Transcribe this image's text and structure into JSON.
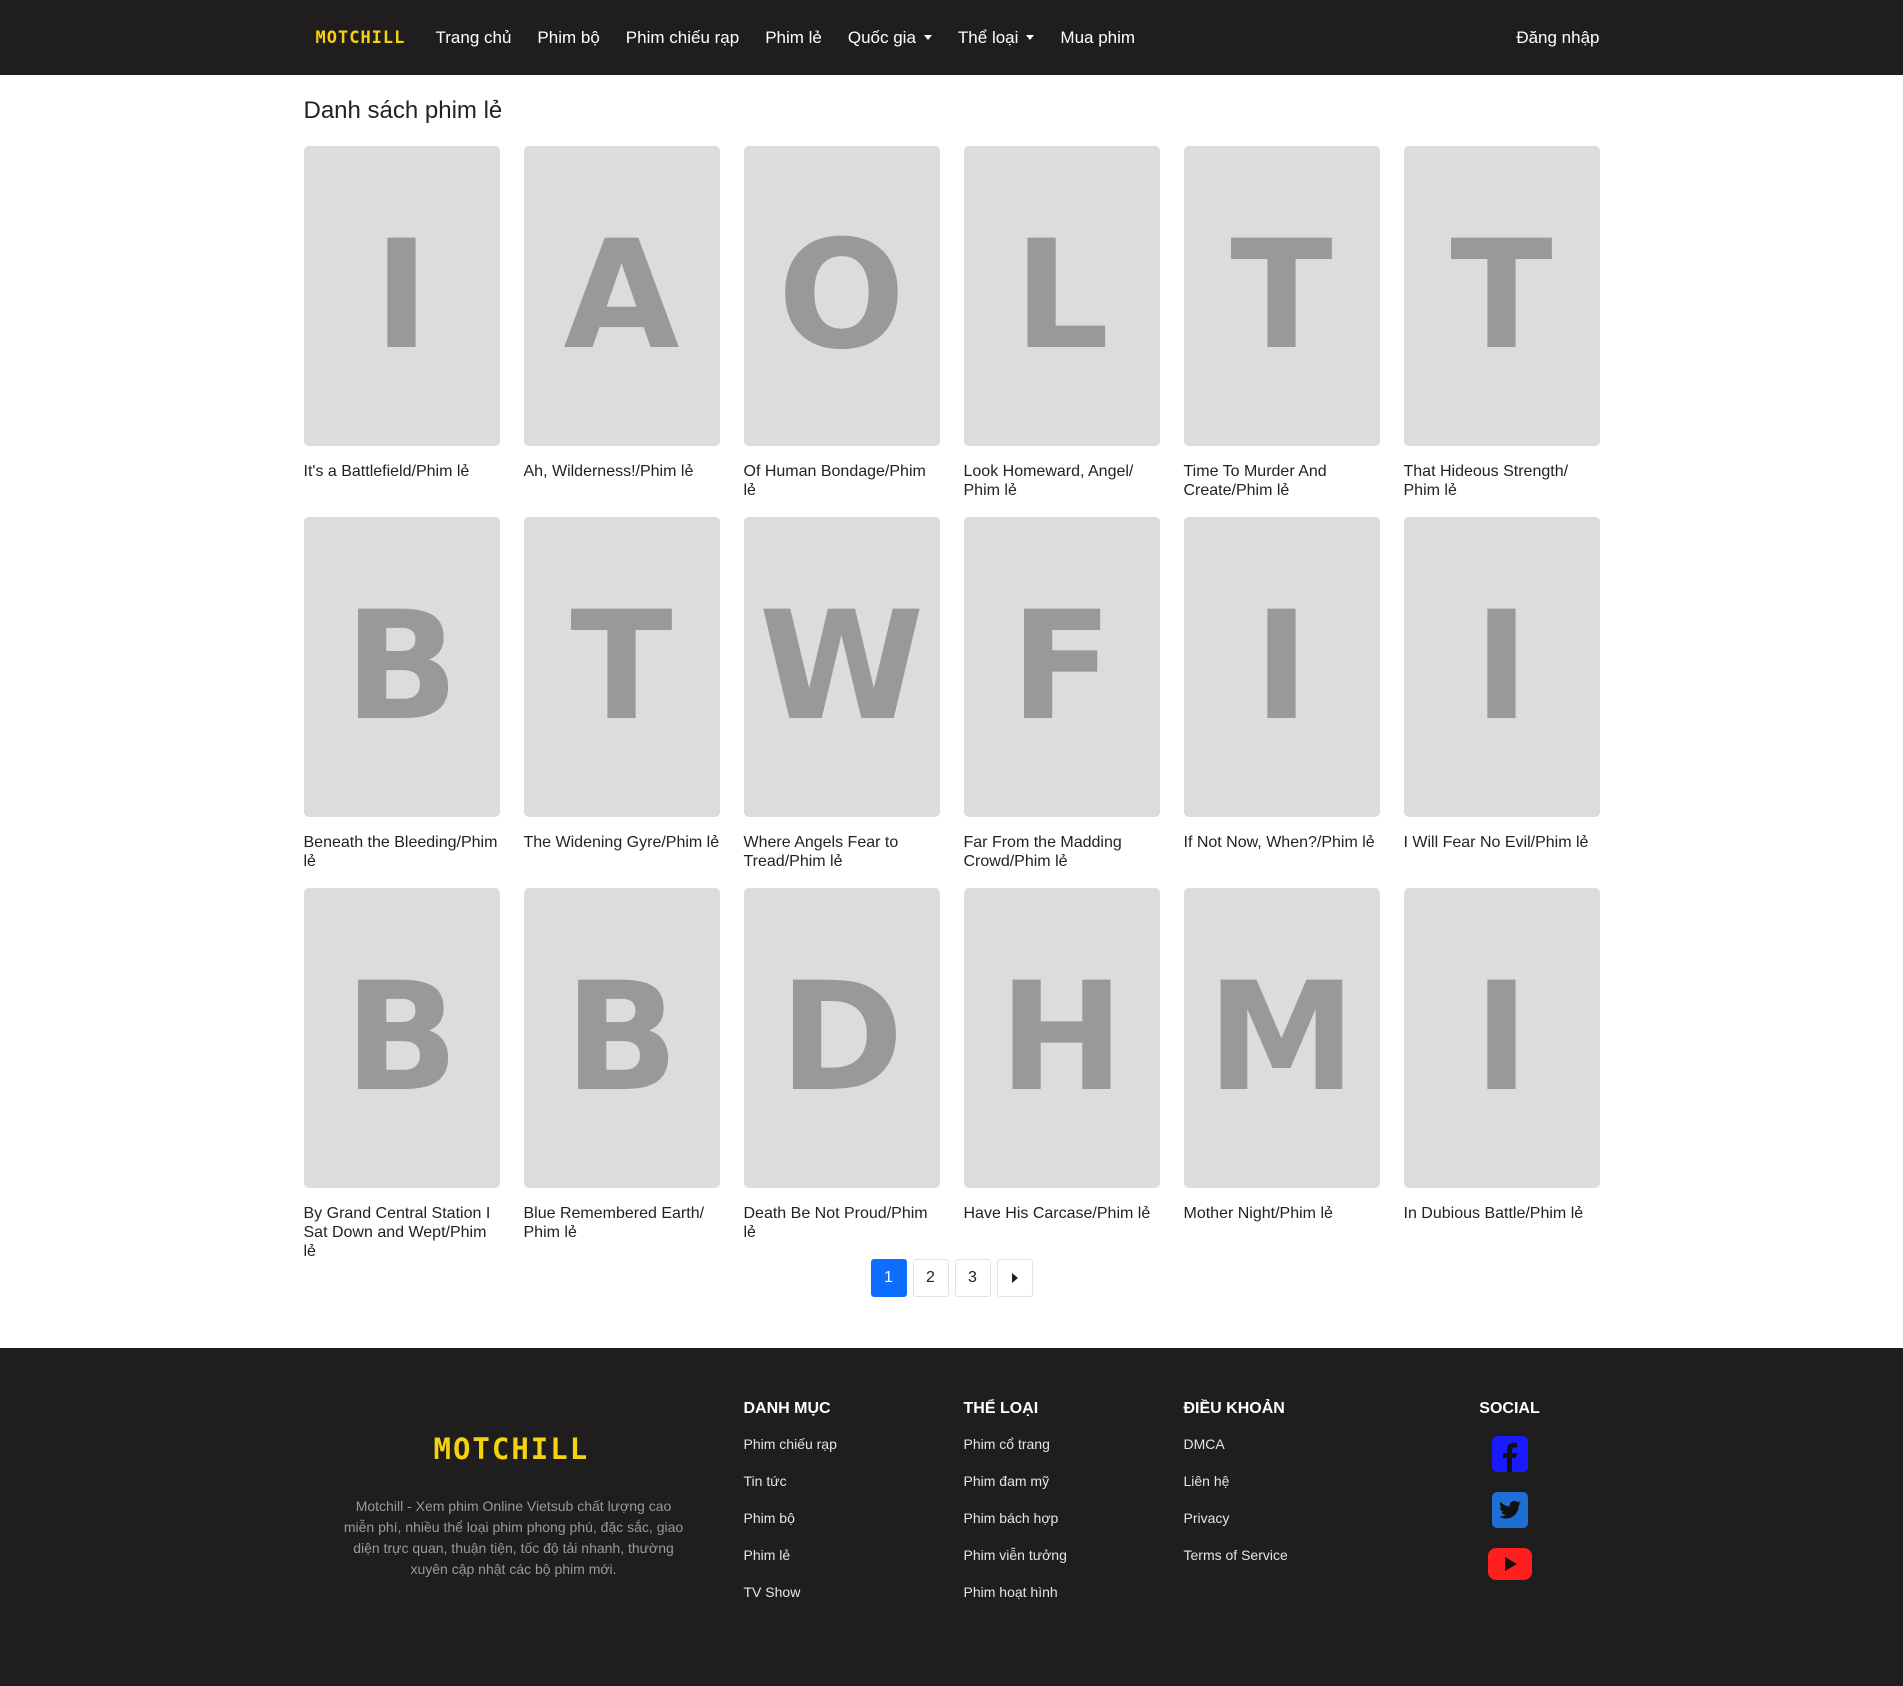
{
  "header": {
    "logo": "MOTCHILL",
    "nav": [
      "Trang chủ",
      "Phim bộ",
      "Phim chiếu rạp",
      "Phim lẻ",
      "Quốc gia",
      "Thể loại",
      "Mua phim"
    ],
    "login": "Đăng nhập"
  },
  "page_title": "Danh sách phim lẻ",
  "movies": [
    {
      "letter": "I",
      "title": "It's a Battlefield/Phim lẻ"
    },
    {
      "letter": "A",
      "title": "Ah, Wilderness!/Phim lẻ"
    },
    {
      "letter": "O",
      "title": "Of Human Bondage/Phim lẻ"
    },
    {
      "letter": "L",
      "title": "Look Homeward, Angel/ Phim lẻ"
    },
    {
      "letter": "T",
      "title": "Time To Murder And Create/Phim lẻ"
    },
    {
      "letter": "T",
      "title": "That Hideous Strength/ Phim lẻ"
    },
    {
      "letter": "B",
      "title": "Beneath the Bleeding/Phim lẻ"
    },
    {
      "letter": "T",
      "title": "The Widening Gyre/Phim lẻ"
    },
    {
      "letter": "W",
      "title": "Where Angels Fear to Tread/Phim lẻ"
    },
    {
      "letter": "F",
      "title": "Far From the Madding Crowd/Phim lẻ"
    },
    {
      "letter": "I",
      "title": "If Not Now, When?/Phim lẻ"
    },
    {
      "letter": "I",
      "title": "I Will Fear No Evil/Phim lẻ"
    },
    {
      "letter": "B",
      "title": "By Grand Central Station I Sat Down and Wept/Phim lẻ"
    },
    {
      "letter": "B",
      "title": "Blue Remembered Earth/ Phim lẻ"
    },
    {
      "letter": "D",
      "title": "Death Be Not Proud/Phim lẻ"
    },
    {
      "letter": "H",
      "title": "Have His Carcase/Phim lẻ"
    },
    {
      "letter": "M",
      "title": "Mother Night/Phim lẻ"
    },
    {
      "letter": "I",
      "title": "In Dubious Battle/Phim lẻ"
    }
  ],
  "pagination": {
    "pages": [
      "1",
      "2",
      "3"
    ],
    "active": "1"
  },
  "footer": {
    "logo": "MOTCHILL",
    "description": "Motchill - Xem phim Online Vietsub chất lượng cao miễn phí, nhiều thể loại phim phong phú, đặc sắc, giao diện trực quan, thuận tiện, tốc độ tải nhanh, thường xuyên cập nhật các bộ phim mới.",
    "columns": [
      {
        "heading": "DANH MỤC",
        "links": [
          "Phim chiếu rạp",
          "Tin tức",
          "Phim bộ",
          "Phim lẻ",
          "TV Show"
        ]
      },
      {
        "heading": "THỂ LOẠI",
        "links": [
          "Phim cổ trang",
          "Phim đam mỹ",
          "Phim bách hợp",
          "Phim viễn tưởng",
          "Phim hoạt hình"
        ]
      },
      {
        "heading": "ĐIỀU KHOẢN",
        "links": [
          "DMCA",
          "Liên hệ",
          "Privacy",
          "Terms of Service"
        ]
      }
    ],
    "social_heading": "SOCIAL",
    "social_icons": [
      "facebook-icon",
      "twitter-icon",
      "youtube-icon"
    ]
  },
  "colors": {
    "header_bg": "#1f1d1e",
    "logo": "#f5d10f",
    "active_page": "#0d6efd",
    "poster_bg": "#dcdcdc",
    "facebook": "#1a1aff",
    "twitter": "#1d6fd6",
    "youtube": "#ff1f1f"
  }
}
